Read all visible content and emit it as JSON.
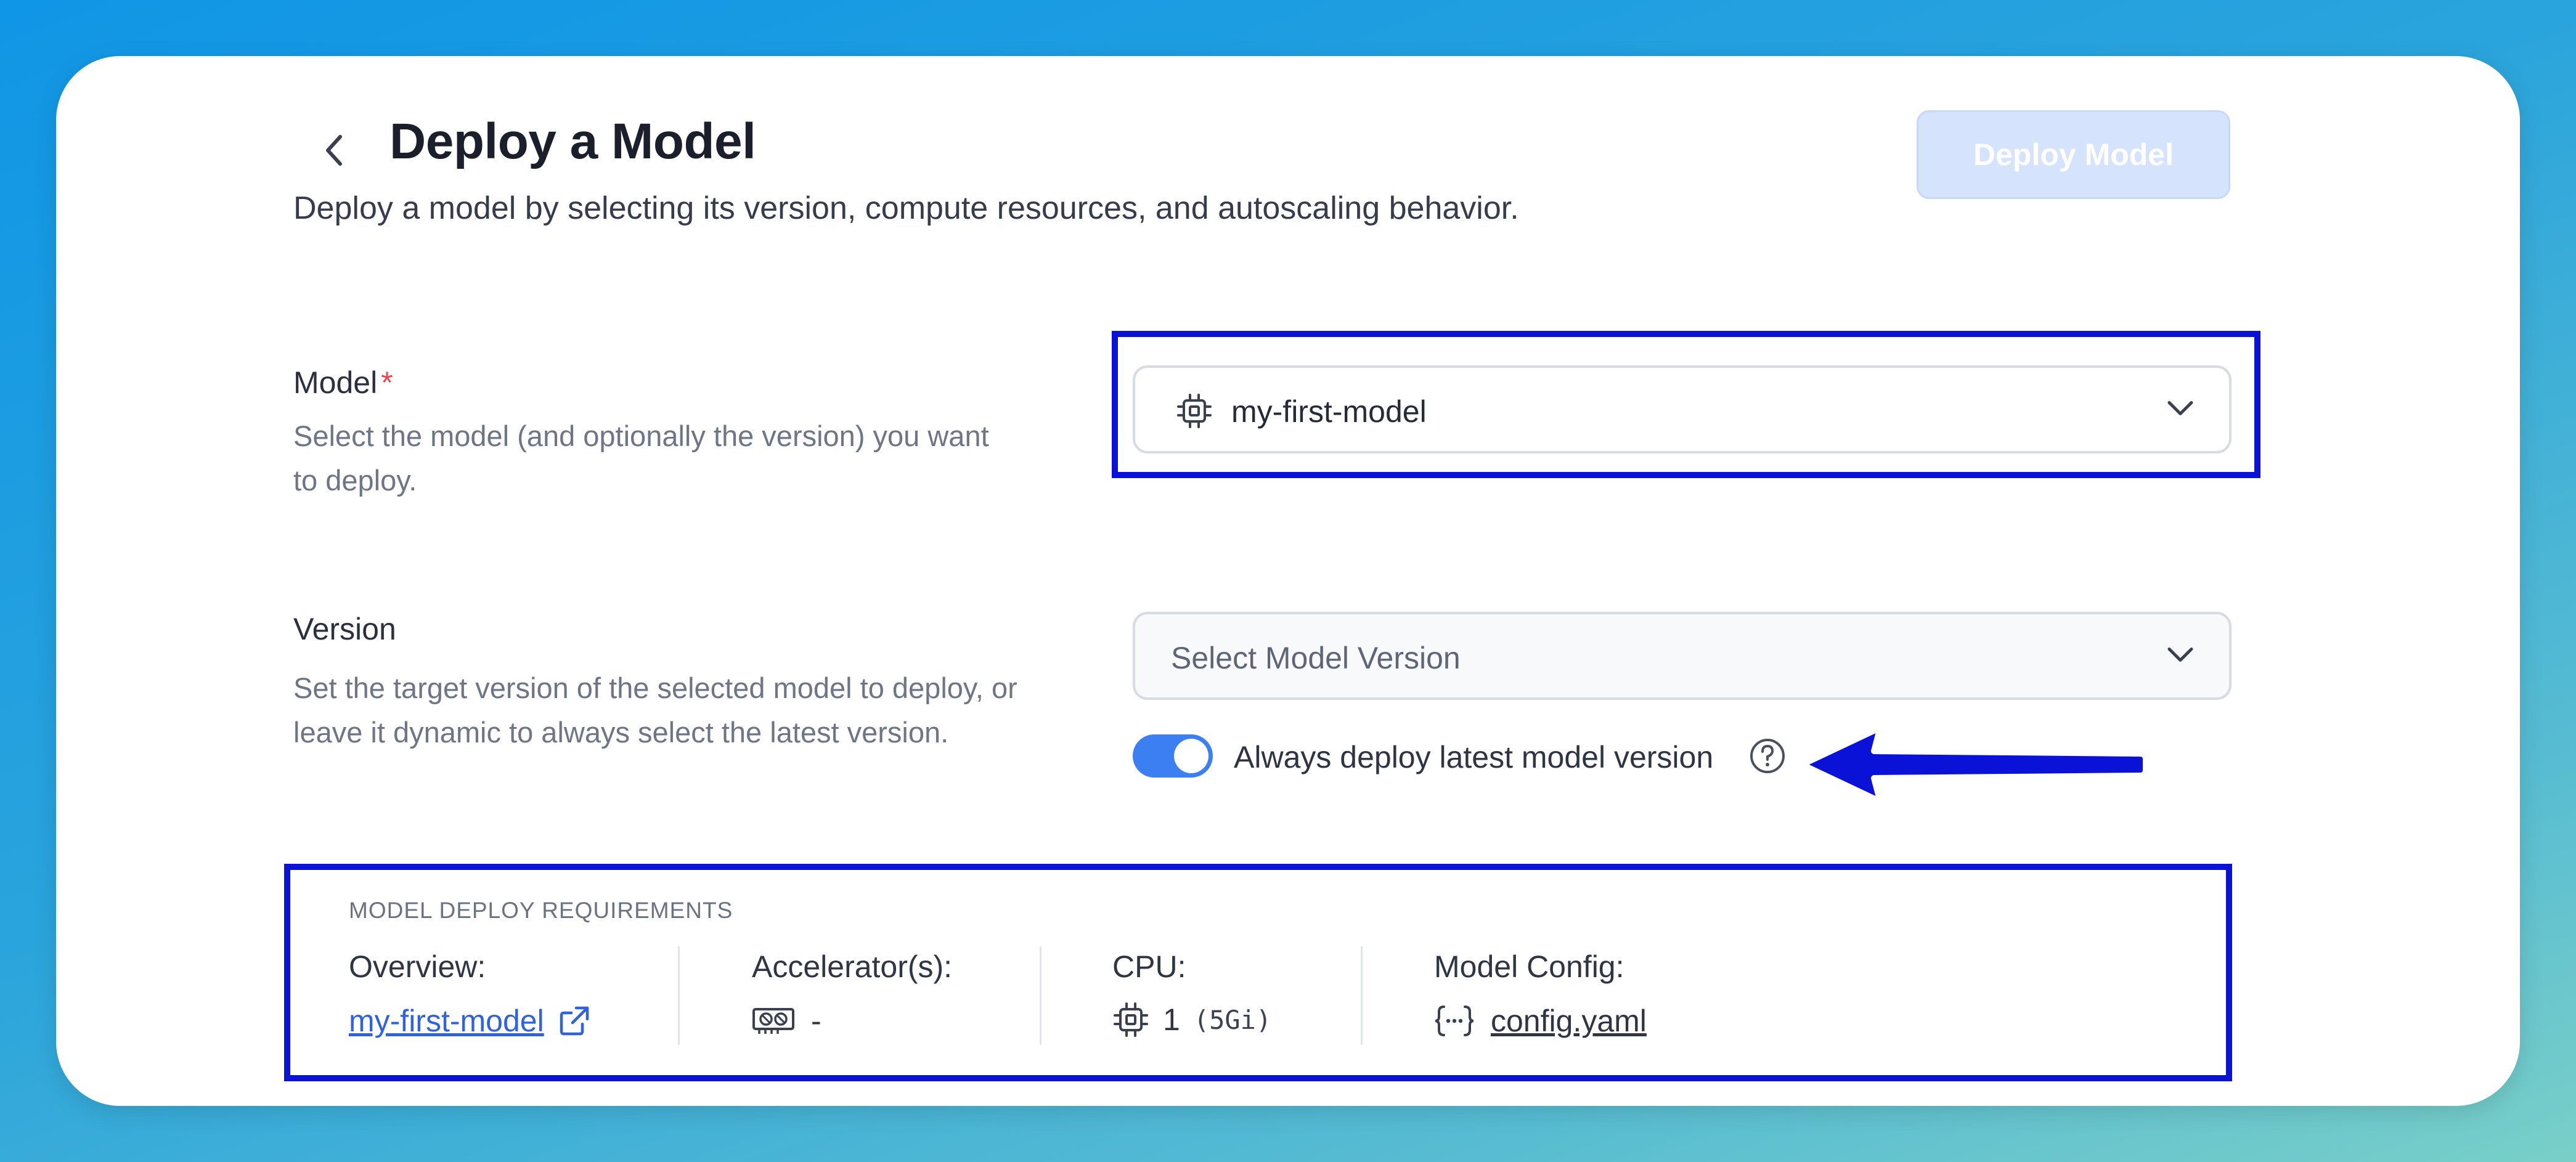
{
  "header": {
    "title": "Deploy a Model",
    "subtitle": "Deploy a model by selecting its version, compute resources, and autoscaling behavior.",
    "deploy_button": "Deploy Model"
  },
  "model_field": {
    "label": "Model",
    "required_mark": "*",
    "help": "Select the model (and optionally the version) you want to deploy.",
    "selected_value": "my-first-model",
    "icon": "cpu-chip-icon"
  },
  "version_field": {
    "label": "Version",
    "help": "Set the target version of the selected model to deploy, or leave it dynamic to always select the latest version.",
    "placeholder": "Select Model Version",
    "toggle_label": "Always deploy latest model version",
    "toggle_on": true
  },
  "requirements": {
    "title": "MODEL DEPLOY REQUIREMENTS",
    "overview_label": "Overview:",
    "overview_link": "my-first-model",
    "accelerator_label": "Accelerator(s):",
    "accelerator_value": "-",
    "cpu_label": "CPU:",
    "cpu_value": "1",
    "cpu_memory": "(5Gi)",
    "config_label": "Model Config:",
    "config_link": "config.yaml"
  },
  "colors": {
    "annotation": "#0a12d8",
    "toggle_on": "#3b7ff2",
    "link": "#2f62dc",
    "required": "#e5484d"
  }
}
